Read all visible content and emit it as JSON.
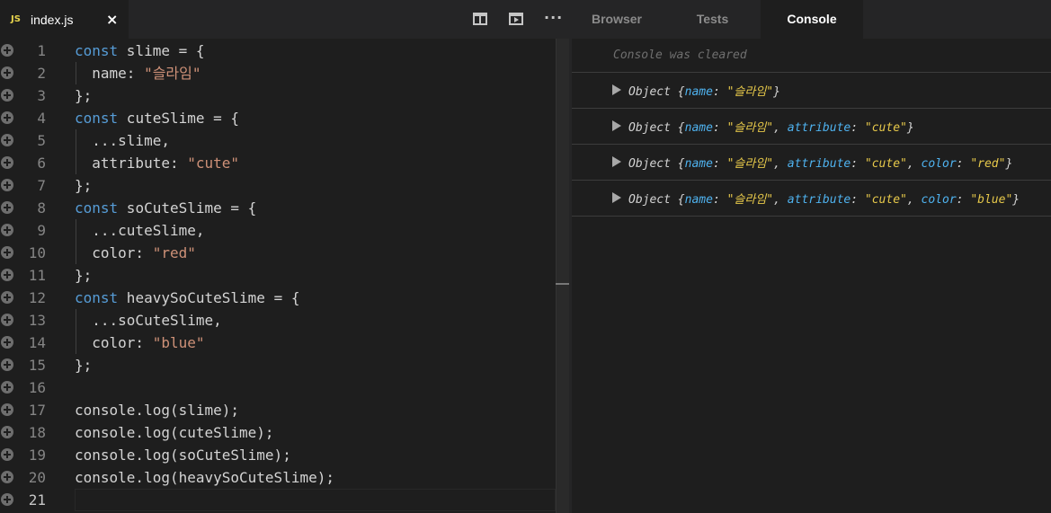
{
  "file_tab": {
    "badge": "JS",
    "name": "index.js",
    "close": "×"
  },
  "panel_tabs": {
    "browser": "Browser",
    "tests": "Tests",
    "console": "Console"
  },
  "editor_actions": {
    "more": "···"
  },
  "icons": [
    "split-editor-icon",
    "open-preview-icon",
    "more-actions-icon",
    "fold-marker-icon",
    "expand-triangle-icon"
  ],
  "colors": {
    "keyword": "#569cd6",
    "string": "#ce9178",
    "console_key": "#4fb3f0",
    "console_value": "#e6c84a"
  },
  "editor": {
    "current_line": 21,
    "lines": [
      [
        {
          "t": "const",
          "c": "k"
        },
        {
          "t": " slime = {",
          "c": "p"
        }
      ],
      [
        {
          "t": "  name: ",
          "c": "p"
        },
        {
          "t": "\"슬라임\"",
          "c": "s"
        }
      ],
      [
        {
          "t": "};",
          "c": "p"
        }
      ],
      [
        {
          "t": "const",
          "c": "k"
        },
        {
          "t": " cuteSlime = {",
          "c": "p"
        }
      ],
      [
        {
          "t": "  ...slime,",
          "c": "p"
        }
      ],
      [
        {
          "t": "  attribute: ",
          "c": "p"
        },
        {
          "t": "\"cute\"",
          "c": "s"
        }
      ],
      [
        {
          "t": "};",
          "c": "p"
        }
      ],
      [
        {
          "t": "const",
          "c": "k"
        },
        {
          "t": " soCuteSlime = {",
          "c": "p"
        }
      ],
      [
        {
          "t": "  ...cuteSlime,",
          "c": "p"
        }
      ],
      [
        {
          "t": "  color: ",
          "c": "p"
        },
        {
          "t": "\"red\"",
          "c": "s"
        }
      ],
      [
        {
          "t": "};",
          "c": "p"
        }
      ],
      [
        {
          "t": "const",
          "c": "k"
        },
        {
          "t": " heavySoCuteSlime = {",
          "c": "p"
        }
      ],
      [
        {
          "t": "  ...soCuteSlime,",
          "c": "p"
        }
      ],
      [
        {
          "t": "  color: ",
          "c": "p"
        },
        {
          "t": "\"blue\"",
          "c": "s"
        }
      ],
      [
        {
          "t": "};",
          "c": "p"
        }
      ],
      [],
      [
        {
          "t": "console.log(slime);",
          "c": "p"
        }
      ],
      [
        {
          "t": "console.log(cuteSlime);",
          "c": "p"
        }
      ],
      [
        {
          "t": "console.log(soCuteSlime);",
          "c": "p"
        }
      ],
      [
        {
          "t": "console.log(heavySoCuteSlime);",
          "c": "p"
        }
      ],
      []
    ],
    "indented_lines": [
      2,
      5,
      6,
      9,
      10,
      13,
      14
    ]
  },
  "console": {
    "cleared": "Console was cleared",
    "entries": [
      [
        {
          "t": "Object {",
          "c": "co"
        },
        {
          "t": "name",
          "c": "ck"
        },
        {
          "t": ": ",
          "c": "co"
        },
        {
          "t": "\"슬라임\"",
          "c": "cv"
        },
        {
          "t": "}",
          "c": "co"
        }
      ],
      [
        {
          "t": "Object {",
          "c": "co"
        },
        {
          "t": "name",
          "c": "ck"
        },
        {
          "t": ": ",
          "c": "co"
        },
        {
          "t": "\"슬라임\"",
          "c": "cv"
        },
        {
          "t": ", ",
          "c": "co"
        },
        {
          "t": "attribute",
          "c": "ck"
        },
        {
          "t": ": ",
          "c": "co"
        },
        {
          "t": "\"cute\"",
          "c": "cv"
        },
        {
          "t": "}",
          "c": "co"
        }
      ],
      [
        {
          "t": "Object {",
          "c": "co"
        },
        {
          "t": "name",
          "c": "ck"
        },
        {
          "t": ": ",
          "c": "co"
        },
        {
          "t": "\"슬라임\"",
          "c": "cv"
        },
        {
          "t": ", ",
          "c": "co"
        },
        {
          "t": "attribute",
          "c": "ck"
        },
        {
          "t": ": ",
          "c": "co"
        },
        {
          "t": "\"cute\"",
          "c": "cv"
        },
        {
          "t": ", ",
          "c": "co"
        },
        {
          "t": "color",
          "c": "ck"
        },
        {
          "t": ": ",
          "c": "co"
        },
        {
          "t": "\"red\"",
          "c": "cv"
        },
        {
          "t": "}",
          "c": "co"
        }
      ],
      [
        {
          "t": "Object {",
          "c": "co"
        },
        {
          "t": "name",
          "c": "ck"
        },
        {
          "t": ": ",
          "c": "co"
        },
        {
          "t": "\"슬라임\"",
          "c": "cv"
        },
        {
          "t": ", ",
          "c": "co"
        },
        {
          "t": "attribute",
          "c": "ck"
        },
        {
          "t": ": ",
          "c": "co"
        },
        {
          "t": "\"cute\"",
          "c": "cv"
        },
        {
          "t": ", ",
          "c": "co"
        },
        {
          "t": "color",
          "c": "ck"
        },
        {
          "t": ": ",
          "c": "co"
        },
        {
          "t": "\"blue\"",
          "c": "cv"
        },
        {
          "t": "}",
          "c": "co"
        }
      ]
    ]
  }
}
